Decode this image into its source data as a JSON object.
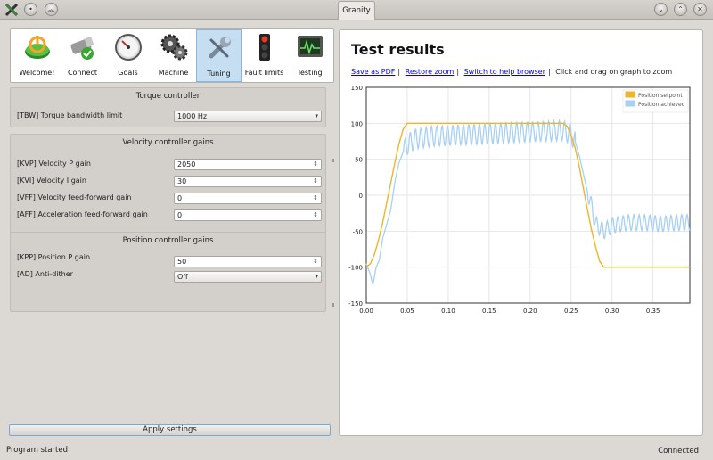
{
  "window": {
    "title": "Granity"
  },
  "toolbar": {
    "items": [
      {
        "label": "Welcome!",
        "icon": "power-icon",
        "active": false
      },
      {
        "label": "Connect",
        "icon": "connector-icon",
        "active": false
      },
      {
        "label": "Goals",
        "icon": "gauge-icon",
        "active": false
      },
      {
        "label": "Machine",
        "icon": "gears-icon",
        "active": false
      },
      {
        "label": "Tuning",
        "icon": "wrench-icon",
        "active": true
      },
      {
        "label": "Fault limits",
        "icon": "traffic-light-icon",
        "active": false
      },
      {
        "label": "Testing",
        "icon": "oscilloscope-icon",
        "active": false
      }
    ]
  },
  "torque": {
    "title": "Torque controller",
    "tbw_label": "[TBW] Torque bandwidth limit",
    "tbw_value": "1000 Hz"
  },
  "velocity": {
    "title": "Velocity controller gains",
    "kvp_label": "[KVP] Velocity P gain",
    "kvp_value": "2050",
    "kvi_label": "[KVI] Velocity I gain",
    "kvi_value": "30",
    "vff_label": "[VFF] Velocity feed-forward gain",
    "vff_value": "0",
    "aff_label": "[AFF] Acceleration feed-forward gain",
    "aff_value": "0"
  },
  "position": {
    "title": "Position controller gains",
    "kpp_label": "[KPP] Position P gain",
    "kpp_value": "50",
    "ad_label": "[AD] Anti-dither",
    "ad_value": "Off"
  },
  "apply_label": "Apply settings",
  "results": {
    "title": "Test results",
    "save_pdf": "Save as PDF",
    "restore_zoom": "Restore zoom",
    "switch_help": "Switch to help browser",
    "hint": "Click and drag on graph to zoom"
  },
  "status": {
    "left": "Program started",
    "right": "Connected"
  },
  "chart_data": {
    "type": "line",
    "xlim": [
      0,
      0.395
    ],
    "ylim": [
      -150,
      150
    ],
    "x_ticks": [
      "0.00",
      "0.05",
      "0.10",
      "0.15",
      "0.20",
      "0.25",
      "0.30",
      "0.35"
    ],
    "y_ticks": [
      "150",
      "100",
      "50",
      "0",
      "-50",
      "-100",
      "-150"
    ],
    "grid": true,
    "legend_position": "top-right",
    "series": [
      {
        "name": "Position setpoint",
        "color": "#f0b429",
        "x": [
          0,
          0.005,
          0.01,
          0.015,
          0.02,
          0.025,
          0.03,
          0.035,
          0.04,
          0.045,
          0.05,
          0.1,
          0.15,
          0.2,
          0.24,
          0.245,
          0.25,
          0.255,
          0.26,
          0.265,
          0.27,
          0.275,
          0.28,
          0.285,
          0.29,
          0.33,
          0.395
        ],
        "y": [
          -100,
          -95,
          -82,
          -62,
          -38,
          -10,
          18,
          46,
          72,
          92,
          100,
          100,
          100,
          100,
          100,
          96,
          84,
          66,
          40,
          10,
          -20,
          -48,
          -72,
          -92,
          -100,
          -100,
          -100
        ]
      },
      {
        "name": "Position achieved",
        "color": "#a8d0f0",
        "x": [
          0,
          0.005,
          0.008,
          0.012,
          0.016,
          0.02,
          0.025,
          0.03,
          0.035,
          0.04,
          0.045,
          0.05,
          0.055,
          0.06,
          0.07,
          0.08,
          0.1,
          0.12,
          0.14,
          0.16,
          0.18,
          0.2,
          0.22,
          0.24,
          0.25,
          0.255,
          0.26,
          0.265,
          0.27,
          0.275,
          0.28,
          0.29,
          0.3,
          0.32,
          0.34,
          0.36,
          0.38,
          0.395
        ],
        "y": [
          -95,
          -110,
          -125,
          -100,
          -90,
          -60,
          -40,
          -20,
          20,
          45,
          60,
          70,
          75,
          78,
          80,
          82,
          83,
          84,
          85,
          86,
          87,
          88,
          89,
          90,
          85,
          75,
          55,
          30,
          5,
          -15,
          -40,
          -50,
          -42,
          -38,
          -38,
          -40,
          -38,
          -38
        ],
        "oscillation_amplitude": 14
      }
    ]
  }
}
